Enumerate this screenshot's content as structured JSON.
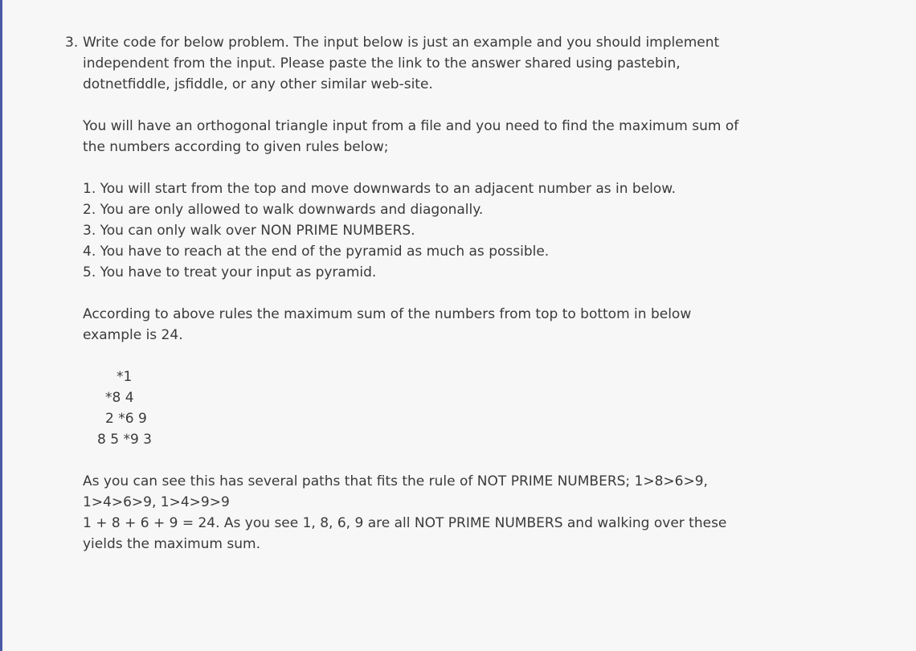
{
  "question": {
    "number": "3.",
    "intro": [
      "Write code for below problem. The input below is just an example and you should implement",
      "independent from the input. Please paste the link to the answer shared using pastebin,",
      "dotnetfiddle, jsfiddle, or any other similar web-site."
    ],
    "description": [
      "You will have an orthogonal triangle input from a file and you need to find the maximum sum of",
      "the numbers according to given rules below;"
    ],
    "rules": [
      "1. You will start from the top and move downwards to an adjacent number as in below.",
      "2. You are only allowed to walk downwards and diagonally.",
      "3. You can only walk over NON PRIME NUMBERS.",
      "4. You have to reach at the end of the pyramid as much as possible.",
      "5. You have to treat your input as pyramid."
    ],
    "example_intro": [
      "According to above rules the maximum sum of the numbers from top to bottom in below",
      "example is 24."
    ],
    "pyramid": [
      "*1",
      "*8 4",
      "2 *6 9",
      "8 5 *9 3"
    ],
    "explanation": [
      "As you can see this has several paths that fits the rule of NOT PRIME NUMBERS; 1>8>6>9,",
      "1>4>6>9, 1>4>9>9",
      "1 + 8 + 6 + 9 = 24.  As you see 1, 8, 6, 9 are all NOT PRIME NUMBERS and walking over these",
      "yields the maximum sum."
    ]
  }
}
